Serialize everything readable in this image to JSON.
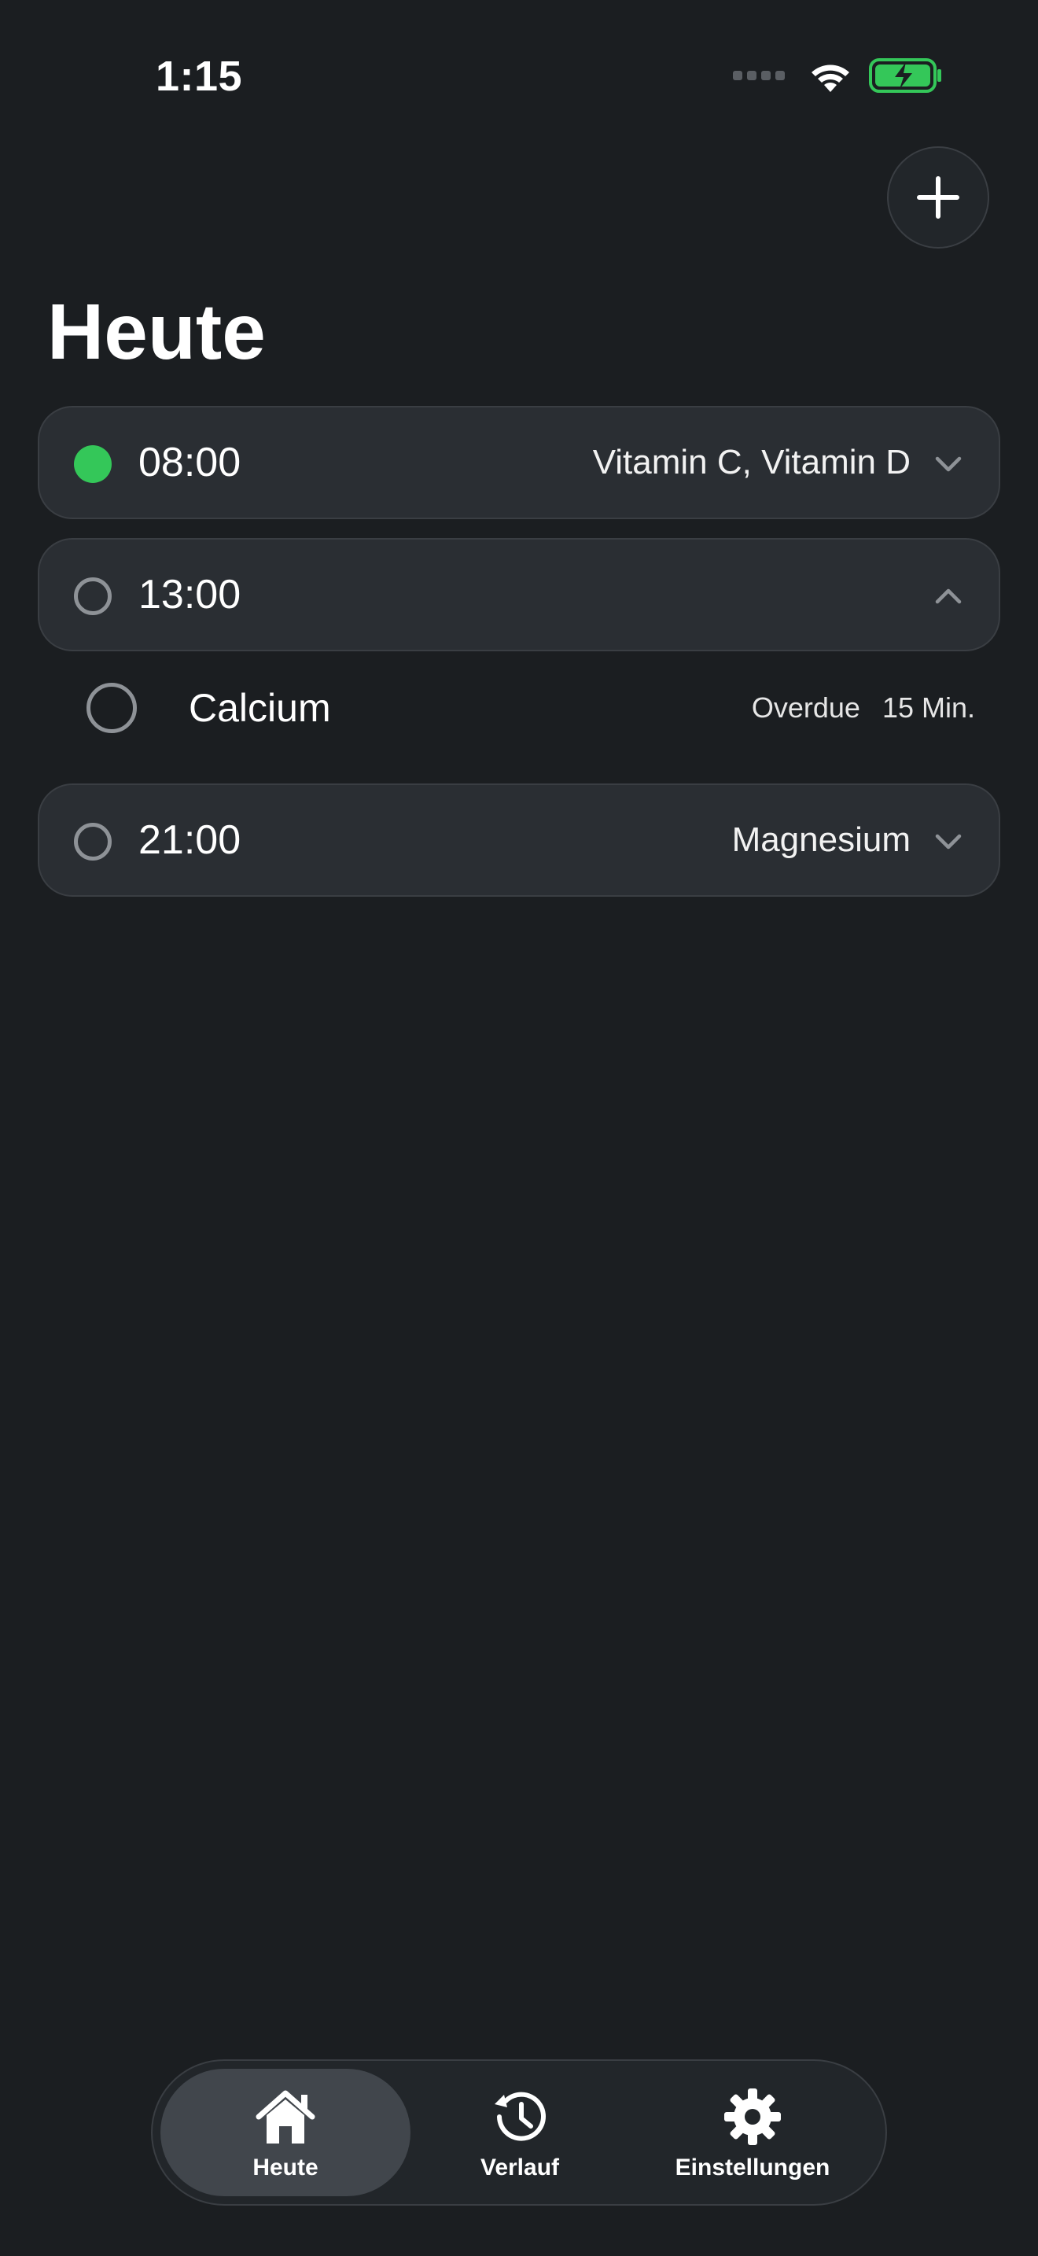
{
  "status_bar": {
    "time": "1:15"
  },
  "header": {
    "title": "Heute"
  },
  "schedule": [
    {
      "time": "08:00",
      "summary": "Vitamin C, Vitamin D",
      "state": "done",
      "expanded": false
    },
    {
      "time": "13:00",
      "summary": "",
      "state": "open",
      "expanded": true,
      "items": [
        {
          "name": "Calcium",
          "status": "Overdue",
          "overdue_by": "15 Min."
        }
      ]
    },
    {
      "time": "21:00",
      "summary": "Magnesium",
      "state": "open",
      "expanded": false
    }
  ],
  "tabbar": {
    "tabs": [
      {
        "label": "Heute",
        "icon": "house-icon",
        "active": true
      },
      {
        "label": "Verlauf",
        "icon": "history-icon",
        "active": false
      },
      {
        "label": "Einstellungen",
        "icon": "gear-icon",
        "active": false
      }
    ]
  },
  "colors": {
    "background": "#1b1e21",
    "card": "#2a2e33",
    "accent_green": "#34c759",
    "text": "#ffffff"
  }
}
